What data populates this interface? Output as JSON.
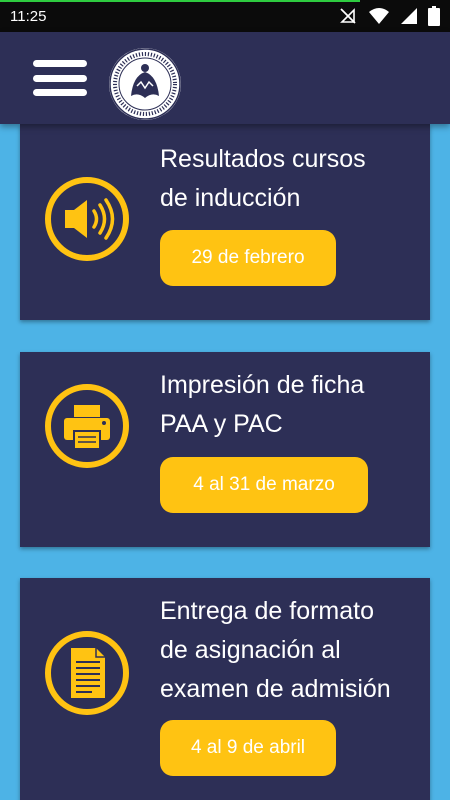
{
  "status_bar": {
    "time": "11:25",
    "icons": [
      "signal-off-icon",
      "wifi-icon",
      "cellular-icon",
      "battery-icon"
    ],
    "progress_fraction": 0.8
  },
  "app_bar": {
    "menu_icon": "hamburger-menu-icon",
    "logo": "university-seal-logo"
  },
  "colors": {
    "background": "#4db3e6",
    "card": "#2d2f56",
    "accent": "#ffc312",
    "text": "#ffffff"
  },
  "cards": [
    {
      "icon": "speaker-icon",
      "title_lines": [
        "Resultados cursos",
        "de inducción"
      ],
      "date": "29 de febrero"
    },
    {
      "icon": "printer-icon",
      "title_lines": [
        "Impresión de ficha",
        "PAA y PAC"
      ],
      "date": "4 al 31 de marzo"
    },
    {
      "icon": "document-icon",
      "title_lines": [
        "Entrega de formato",
        "de asignación al",
        "examen de admisión"
      ],
      "date": "4 al 9 de abril"
    }
  ]
}
